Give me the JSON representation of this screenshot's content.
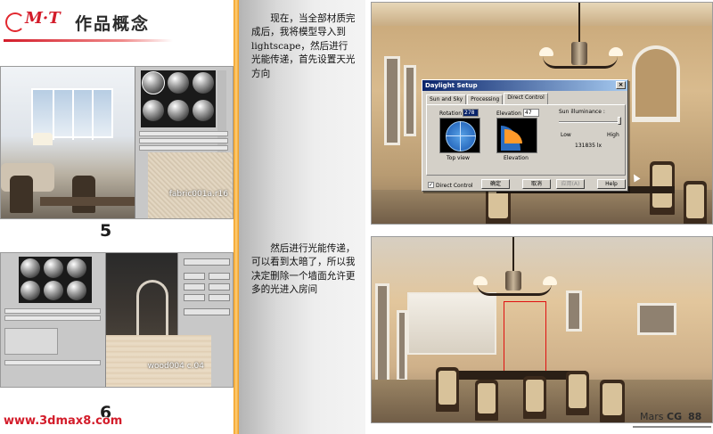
{
  "header": {
    "logo_text": "M·T",
    "section_title": "作品概念"
  },
  "left_column": {
    "figure1": {
      "number": "5",
      "swatch_label": "fabric001a.r16"
    },
    "figure2": {
      "number": "6",
      "swatch_label": "wood004 c.04"
    }
  },
  "footer": {
    "site_url": "www.3dmax8.com"
  },
  "text": {
    "paragraph1": "现在，当全部材质完成后，我将模型导入到 lightscape，然后进行光能传递，首先设置天光方向",
    "paragraph2": "然后进行光能传递，可以看到太暗了，所以我决定删除一个墙面允许更多的光进入房间"
  },
  "dialog": {
    "title": "Daylight Setup",
    "close_label": "×",
    "tabs": [
      "Sun and Sky",
      "Processing",
      "Direct Control"
    ],
    "active_tab": "Direct Control",
    "rotation_label": "Rotation",
    "rotation_value": "278",
    "elevation_label": "Elevation",
    "elevation_value": "47",
    "top_view_label": "Top view",
    "elevation_view_label": "Elevation",
    "sun_illuminance_label": "Sun illuminance :",
    "low_label": "Low",
    "high_label": "High",
    "illuminance_value": "131835 lx",
    "direct_control_label": "Direct Control",
    "direct_control_checked": true,
    "ok_button": "确定",
    "cancel_button": "取消",
    "apply_button": "应用(A)",
    "help_button": "Help"
  },
  "brand": {
    "prefix": "Mars",
    "suffix": "CG",
    "page_number": "88"
  }
}
